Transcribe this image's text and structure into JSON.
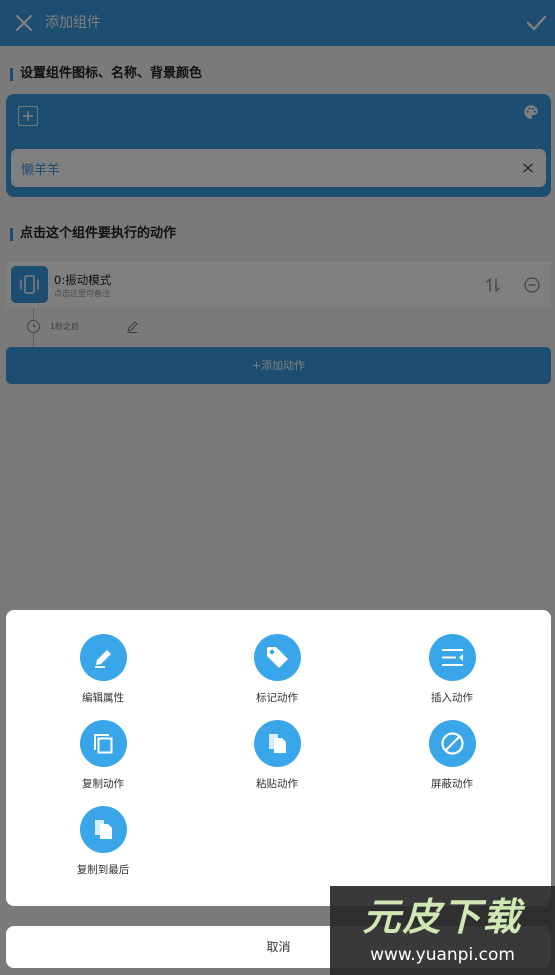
{
  "appbar": {
    "title": "添加组件",
    "close_icon": "close-icon",
    "confirm_icon": "check-icon"
  },
  "section_icon": {
    "title": "设置组件图标、名称、背景颜色",
    "add_icon": "plus-icon",
    "palette_icon": "palette-icon",
    "name_value": "懒羊羊",
    "clear_icon": "close-icon"
  },
  "section_actions": {
    "title": "点击这个组件要执行的动作",
    "actions": [
      {
        "name": "0:振动模式",
        "note": "点击这里可备注",
        "icon": "vibrate-icon",
        "delay": "1秒之后"
      }
    ],
    "add_action_label": "+添加动作"
  },
  "sheet": {
    "items": [
      {
        "label": "编辑属性",
        "icon": "pencil-icon"
      },
      {
        "label": "标记动作",
        "icon": "tag-icon"
      },
      {
        "label": "插入动作",
        "icon": "insert-icon"
      },
      {
        "label": "复制动作",
        "icon": "copy-icon"
      },
      {
        "label": "粘贴动作",
        "icon": "paste-icon"
      },
      {
        "label": "屏蔽动作",
        "icon": "block-icon"
      },
      {
        "label": "复制到最后",
        "icon": "copy-to-end-icon"
      }
    ],
    "cancel_label": "取消"
  },
  "watermark": {
    "logo": "元皮下载",
    "url": "www.yuanpi.com"
  },
  "colors": {
    "primary": "#3a9be0",
    "menu_circle": "#3aa6ea",
    "overlay": "rgba(0,0,0,0.5)"
  }
}
